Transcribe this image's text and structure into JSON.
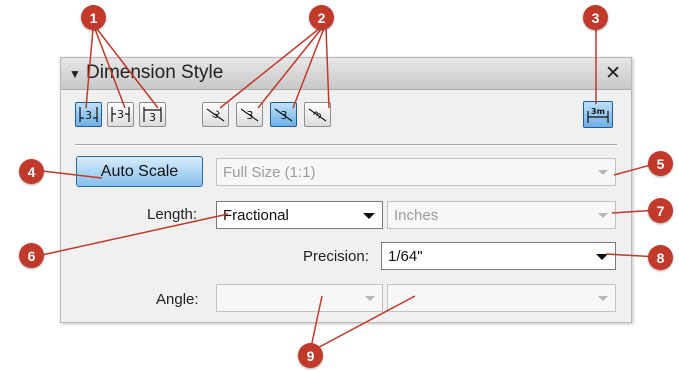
{
  "callouts": [
    "1",
    "2",
    "3",
    "4",
    "5",
    "6",
    "7",
    "8",
    "9"
  ],
  "panel": {
    "title": "Dimension Style",
    "collapse_glyph": "▼",
    "close_glyph": "✕"
  },
  "toolbar": {
    "placement_buttons": [
      {
        "icon": "dimension-text-inline-icon",
        "text": "3",
        "active": true
      },
      {
        "icon": "dimension-text-centered-icon",
        "text": "3",
        "active": false
      },
      {
        "icon": "dimension-text-above-icon",
        "text": "3",
        "active": false
      }
    ],
    "orientation_buttons": [
      {
        "icon": "text-aligned-with-line-icon",
        "text": "3",
        "active": false
      },
      {
        "icon": "text-aligned-tilted-icon",
        "text": "3",
        "active": false
      },
      {
        "icon": "text-aligned-horizontal-icon",
        "text": "3",
        "active": true
      },
      {
        "icon": "text-aligned-rotated-icon",
        "text": "3",
        "active": false
      }
    ],
    "units_button": {
      "icon": "show-units-icon",
      "text": "3m",
      "active": true
    }
  },
  "auto_scale": {
    "label": "Auto Scale"
  },
  "scale_select": {
    "value": "Full Size (1:1)",
    "enabled": false
  },
  "length": {
    "label": "Length:",
    "format_value": "Fractional",
    "units_value": "Inches"
  },
  "precision": {
    "label": "Precision:",
    "value": "1/64\""
  },
  "angle": {
    "label": "Angle:",
    "format_value": "",
    "precision_value": ""
  },
  "colors": {
    "callout": "#c0392b",
    "active_button": "#6fb0e5"
  }
}
